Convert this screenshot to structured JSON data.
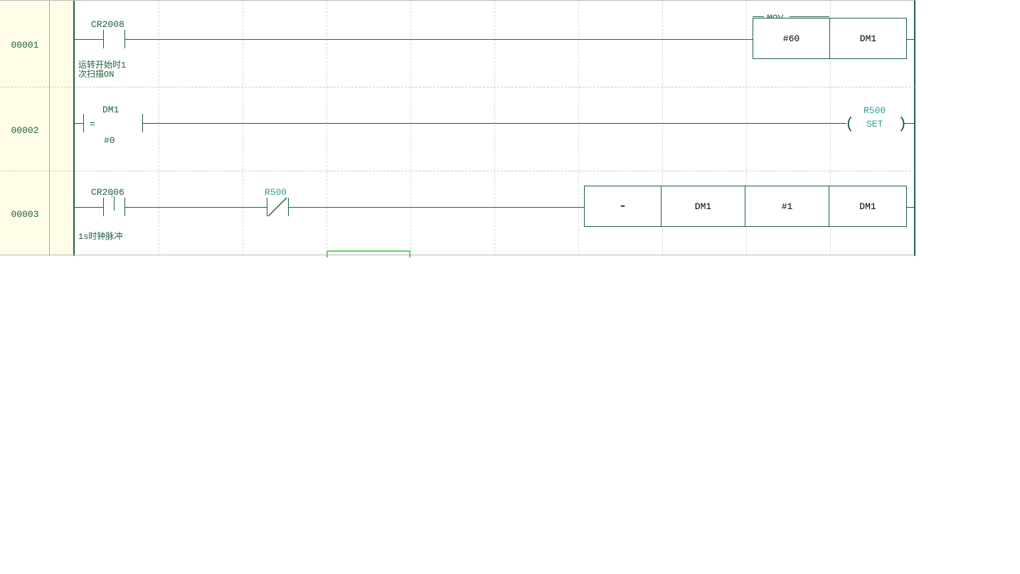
{
  "rungs": [
    {
      "number": "00001",
      "contact1": {
        "address": "CR2008",
        "comment": "运转开始时1\n次扫描ON"
      },
      "instruction": {
        "name": "MOV",
        "op1": "#60",
        "op2": "DM1"
      }
    },
    {
      "number": "00002",
      "compare": {
        "op": "=",
        "top": "DM1",
        "bottom": "#0"
      },
      "coil": {
        "address": "R500",
        "type": "SET"
      }
    },
    {
      "number": "00003",
      "contact1": {
        "address": "CR2006",
        "comment": "1s时钟脉冲"
      },
      "contact2": {
        "address": "R500"
      },
      "instruction": {
        "name": "-",
        "op1": "DM1",
        "op2": "#1",
        "op3": "DM1"
      }
    }
  ]
}
